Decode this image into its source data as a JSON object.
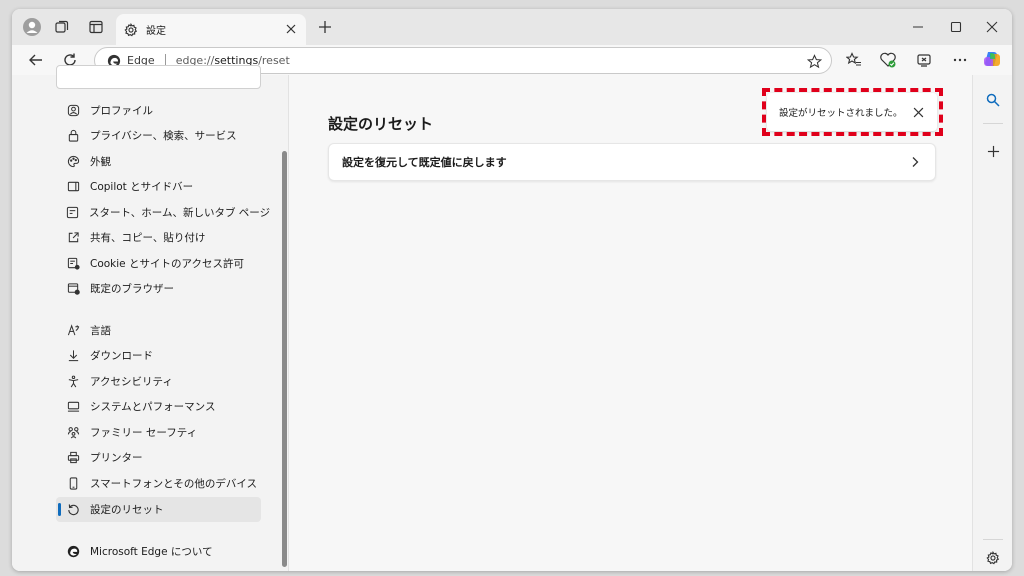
{
  "tab": {
    "title": "設定"
  },
  "address": {
    "site_label": "Edge",
    "url_prefix": "edge://",
    "url_main": "settings",
    "url_suffix": "/reset"
  },
  "sidebar": {
    "items": [
      {
        "label": "プロファイル",
        "icon": "profile-icon"
      },
      {
        "label": "プライバシー、検索、サービス",
        "icon": "lock-icon"
      },
      {
        "label": "外観",
        "icon": "palette-icon"
      },
      {
        "label": "Copilot とサイドバー",
        "icon": "sidebar-icon"
      },
      {
        "label": "スタート、ホーム、新しいタブ ページ",
        "icon": "home-page-icon"
      },
      {
        "label": "共有、コピー、貼り付け",
        "icon": "share-icon"
      },
      {
        "label": "Cookie とサイトのアクセス許可",
        "icon": "site-permissions-icon"
      },
      {
        "label": "既定のブラウザー",
        "icon": "default-browser-icon"
      },
      {
        "label": "言語",
        "icon": "language-icon"
      },
      {
        "label": "ダウンロード",
        "icon": "download-icon"
      },
      {
        "label": "アクセシビリティ",
        "icon": "accessibility-icon"
      },
      {
        "label": "システムとパフォーマンス",
        "icon": "system-icon"
      },
      {
        "label": "ファミリー セーフティ",
        "icon": "family-icon"
      },
      {
        "label": "プリンター",
        "icon": "printer-icon"
      },
      {
        "label": "スマートフォンとその他のデバイス",
        "icon": "phone-icon"
      },
      {
        "label": "設定のリセット",
        "icon": "reset-icon"
      },
      {
        "label": "Microsoft Edge について",
        "icon": "edge-logo-icon"
      }
    ],
    "active_index": 15
  },
  "main": {
    "title": "設定のリセット",
    "card_label": "設定を復元して既定値に戻します"
  },
  "toast": {
    "message": "設定がリセットされました。"
  },
  "colors": {
    "accent": "#0f6cbd",
    "highlight": "#e0001b"
  }
}
